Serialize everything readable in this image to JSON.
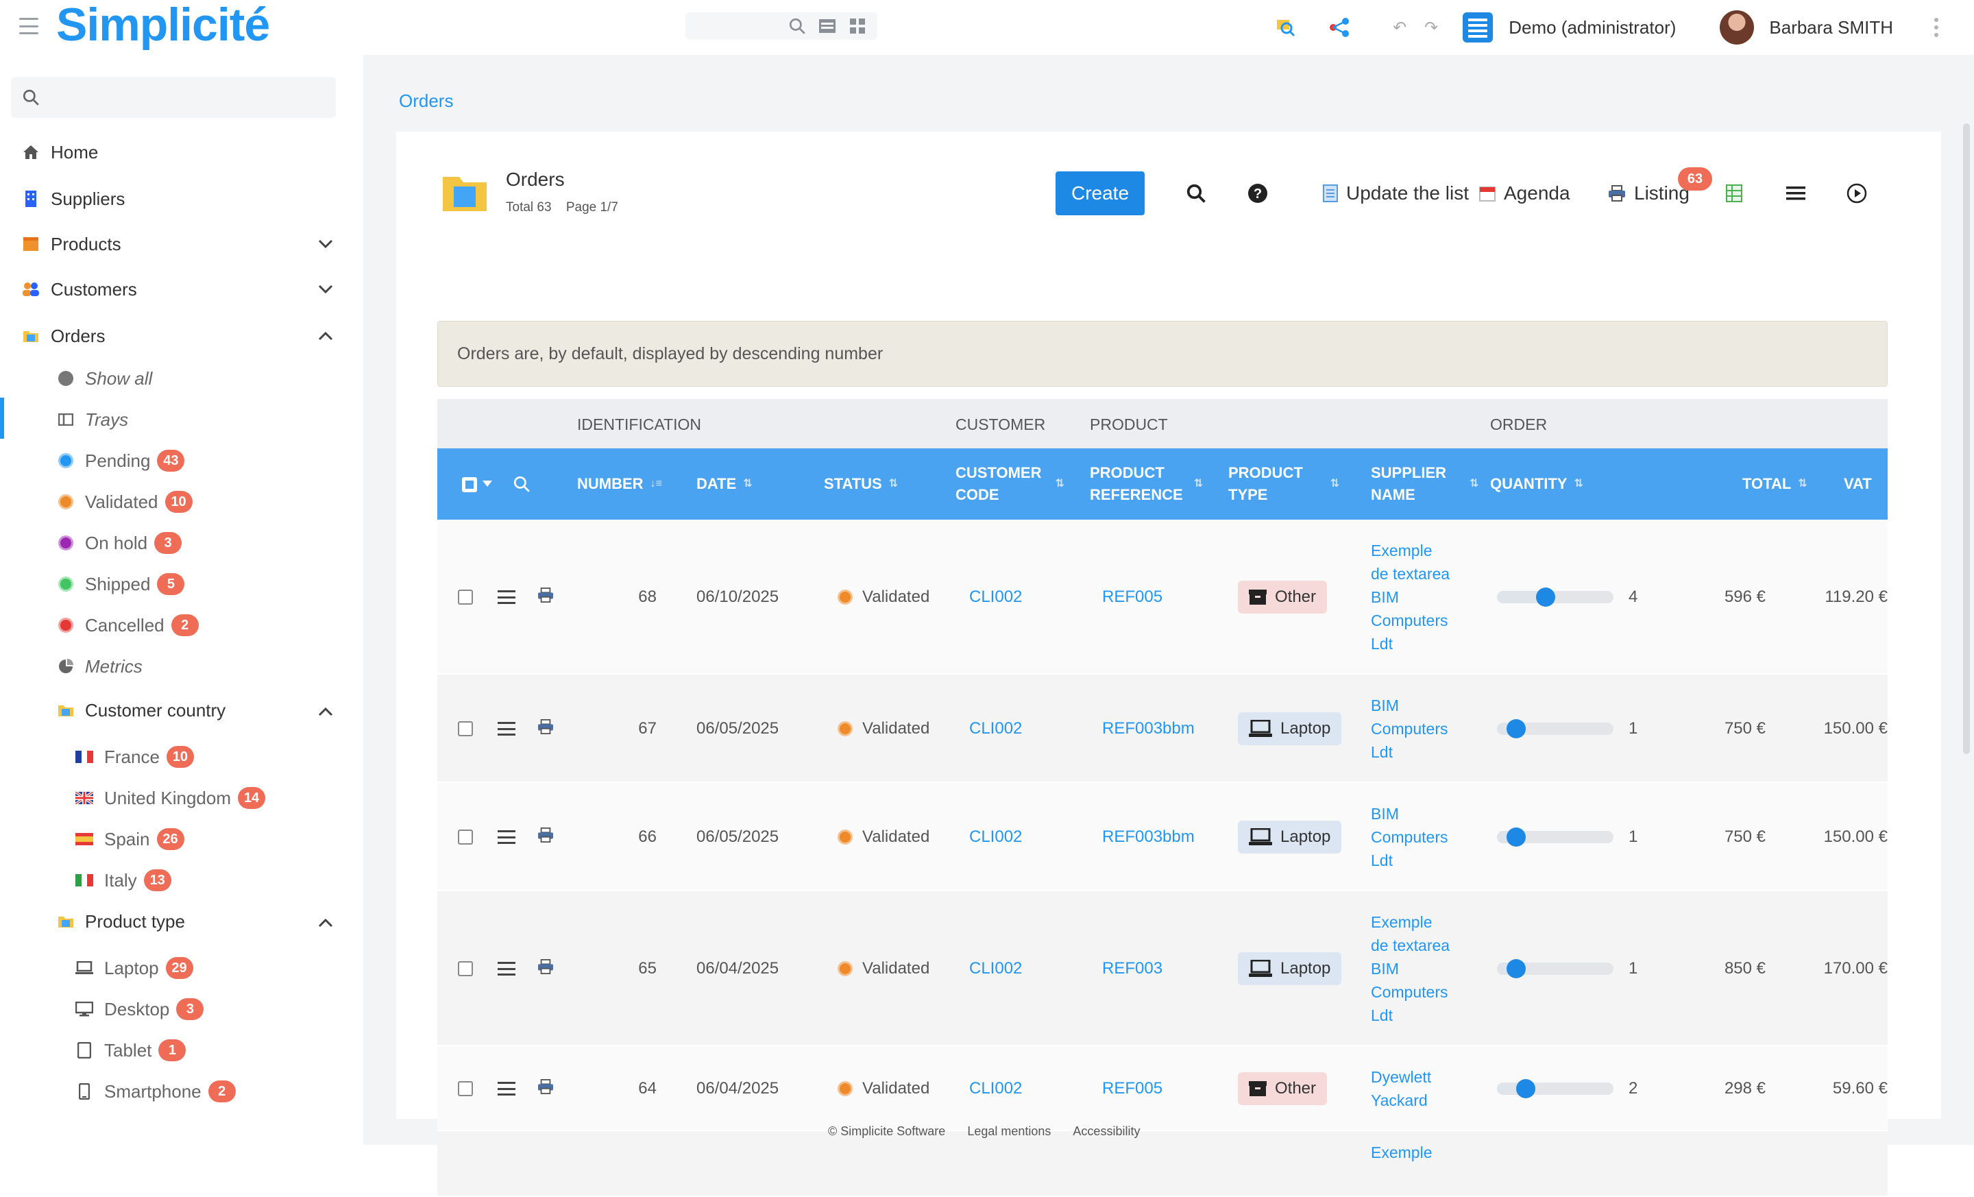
{
  "app": {
    "logo": "Simplicité",
    "role": "Demo (administrator)",
    "user": "Barbara SMITH"
  },
  "sidebar": {
    "search_placeholder": "",
    "items": [
      {
        "label": "Home",
        "icon": "home-icon"
      },
      {
        "label": "Suppliers",
        "icon": "suppliers-icon"
      },
      {
        "label": "Products",
        "icon": "products-icon"
      },
      {
        "label": "Customers",
        "icon": "customers-icon"
      },
      {
        "label": "Orders",
        "icon": "orders-icon"
      }
    ],
    "orders_sub": [
      {
        "label": "Show all"
      },
      {
        "label": "Trays"
      },
      {
        "label": "Pending",
        "count": "43",
        "color": "#2196f3"
      },
      {
        "label": "Validated",
        "count": "10",
        "color": "#ef8a2a"
      },
      {
        "label": "On hold",
        "count": "3",
        "color": "#9c27b0"
      },
      {
        "label": "Shipped",
        "count": "5",
        "color": "#43c463"
      },
      {
        "label": "Cancelled",
        "count": "2",
        "color": "#e53935"
      },
      {
        "label": "Metrics"
      }
    ],
    "country_group": "Customer country",
    "countries": [
      {
        "label": "France",
        "count": "10"
      },
      {
        "label": "United Kingdom",
        "count": "14"
      },
      {
        "label": "Spain",
        "count": "26"
      },
      {
        "label": "Italy",
        "count": "13"
      }
    ],
    "ptype_group": "Product type",
    "ptypes": [
      {
        "label": "Laptop",
        "count": "29"
      },
      {
        "label": "Desktop",
        "count": "3"
      },
      {
        "label": "Tablet",
        "count": "1"
      },
      {
        "label": "Smartphone",
        "count": "2"
      }
    ]
  },
  "breadcrumb": "Orders",
  "list": {
    "title": "Orders",
    "total": "Total 63",
    "page": "Page 1/7",
    "create": "Create",
    "update": "Update the list",
    "agenda": "Agenda",
    "listing": "Listing",
    "listing_count": "63",
    "info": "Orders are, by default, displayed by descending number"
  },
  "groups": {
    "identification": "IDENTIFICATION",
    "customer": "CUSTOMER",
    "product": "PRODUCT",
    "order": "ORDER"
  },
  "columns": {
    "number": "NUMBER",
    "date": "DATE",
    "status": "STATUS",
    "customer_code_1": "CUSTOMER",
    "customer_code_2": "CODE",
    "product_ref_1": "PRODUCT",
    "product_ref_2": "REFERENCE",
    "product_type_1": "PRODUCT",
    "product_type_2": "TYPE",
    "supplier_1": "SUPPLIER",
    "supplier_2": "NAME",
    "quantity": "QUANTITY",
    "total": "TOTAL",
    "vat": "VAT"
  },
  "rows": [
    {
      "number": "68",
      "date": "06/10/2025",
      "status": "Validated",
      "customer": "CLI002",
      "ref": "REF005",
      "ptype": "Other",
      "supplier": [
        "Exemple",
        "de textarea",
        "BIM",
        "Computers",
        "Ldt"
      ],
      "quantity": "4",
      "qty_level": 0.4,
      "total": "596 €",
      "vat": "119.20 €"
    },
    {
      "number": "67",
      "date": "06/05/2025",
      "status": "Validated",
      "customer": "CLI002",
      "ref": "REF003bbm",
      "ptype": "Laptop",
      "supplier": [
        "BIM",
        "Computers",
        "Ldt"
      ],
      "quantity": "1",
      "qty_level": 0.1,
      "total": "750 €",
      "vat": "150.00 €"
    },
    {
      "number": "66",
      "date": "06/05/2025",
      "status": "Validated",
      "customer": "CLI002",
      "ref": "REF003bbm",
      "ptype": "Laptop",
      "supplier": [
        "BIM",
        "Computers",
        "Ldt"
      ],
      "quantity": "1",
      "qty_level": 0.1,
      "total": "750 €",
      "vat": "150.00 €"
    },
    {
      "number": "65",
      "date": "06/04/2025",
      "status": "Validated",
      "customer": "CLI002",
      "ref": "REF003",
      "ptype": "Laptop",
      "supplier": [
        "Exemple",
        "de textarea",
        "BIM",
        "Computers",
        "Ldt"
      ],
      "quantity": "1",
      "qty_level": 0.1,
      "total": "850 €",
      "vat": "170.00 €"
    },
    {
      "number": "64",
      "date": "06/04/2025",
      "status": "Validated",
      "customer": "CLI002",
      "ref": "REF005",
      "ptype": "Other",
      "supplier": [
        "Dyewlett",
        "Yackard"
      ],
      "quantity": "2",
      "qty_level": 0.2,
      "total": "298 €",
      "vat": "59.60 €"
    }
  ],
  "next_row_supplier": "Exemple",
  "footer": {
    "copyright": "© Simplicite Software",
    "legal": "Legal mentions",
    "accessibility": "Accessibility"
  },
  "colors": {
    "accent": "#2196f3",
    "header_bar": "#4aa3f0",
    "badge": "#ef6c57",
    "validated": "#ef8a2a"
  }
}
